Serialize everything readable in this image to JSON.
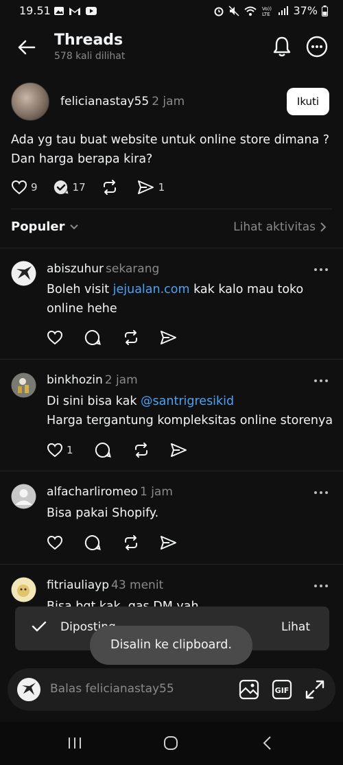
{
  "status": {
    "time": "19.51",
    "battery": "37%"
  },
  "header": {
    "title": "Threads",
    "views": "578 kali dilihat"
  },
  "post": {
    "username": "felicianastay55",
    "time": "2 jam",
    "follow_label": "Ikuti",
    "text": "Ada yg tau buat website untuk online store dimana ? Dan harga berapa kira?",
    "likes": "9",
    "replies": "17",
    "shares": "1"
  },
  "filter": {
    "sort_label": "Populer",
    "activity_label": "Lihat aktivitas"
  },
  "replies": [
    {
      "username": "abiszuhur",
      "time": "sekarang",
      "text_before": "Boleh visit ",
      "link": "jejualan.com",
      "text_after": " kak kalo mau toko online hehe",
      "likes": ""
    },
    {
      "username": "binkhozin",
      "time": "2 jam",
      "text_before": "Di sini bisa kak ",
      "link": "@santrigresikid",
      "text_after": "",
      "text_line2": "Harga tergantung kompleksitas online storenya",
      "likes": "1"
    },
    {
      "username": "alfacharliromeo",
      "time": "1 jam",
      "text_before": "Bisa pakai Shopify.",
      "link": "",
      "text_after": "",
      "likes": ""
    },
    {
      "username": "fitriauliayp",
      "time": "43 menit",
      "text_before": "Bisa bgt kak, gas DM yah",
      "link": "",
      "text_after": "",
      "likes": ""
    }
  ],
  "toast": {
    "message": "Diposting",
    "action": "Lihat"
  },
  "clipboard_toast": "Disalin ke clipboard.",
  "composer": {
    "placeholder": "Balas felicianastay55"
  },
  "colors": {
    "background": "#101010",
    "link": "#4aa3f5",
    "secondary_text": "#8a8a8a"
  }
}
